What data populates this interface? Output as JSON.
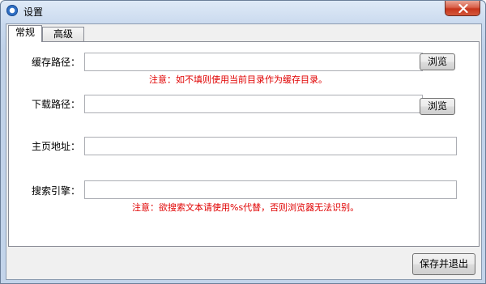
{
  "window": {
    "title": "设置"
  },
  "tabs": [
    {
      "label": "常规",
      "active": true
    },
    {
      "label": "高级",
      "active": false
    }
  ],
  "general": {
    "cache_path": {
      "label": "缓存路径：",
      "value": "",
      "browse_label": "浏览"
    },
    "cache_note": "注意：如不填则使用当前目录作为缓存目录。",
    "download_path": {
      "label": "下载路径：",
      "value": "",
      "browse_label": "浏览"
    },
    "homepage": {
      "label": "主页地址：",
      "value": ""
    },
    "search_engine": {
      "label": "搜索引擎：",
      "value": ""
    },
    "search_note": "注意：欲搜索文本请使用%s代替，否则浏览器无法识别。"
  },
  "footer": {
    "save_exit_label": "保存并退出"
  },
  "colors": {
    "note_red": "#e00000",
    "close_red": "#c6351c"
  }
}
